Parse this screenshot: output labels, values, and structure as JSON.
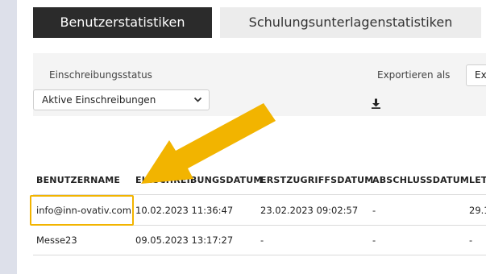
{
  "tabs": [
    {
      "label": "Benutzerstatistiken",
      "active": true
    },
    {
      "label": "Schulungsunterlagenstatistiken",
      "active": false
    }
  ],
  "filter": {
    "label": "Einschreibungsstatus",
    "selected": "Aktive Einschreibungen"
  },
  "export": {
    "label": "Exportieren als",
    "selected": "Ex"
  },
  "table": {
    "columns": [
      "BENUTZERNAME",
      "EINSCHREIBUNGSDATUM",
      "ERSTZUGRIFFSDATUM",
      "ABSCHLUSSDATUM",
      "LET"
    ],
    "rows": [
      [
        "info@inn-ovativ.com",
        "10.02.2023 11:36:47",
        "23.02.2023 09:02:57",
        "-",
        "29.1"
      ],
      [
        "Messe23",
        "09.05.2023 13:17:27",
        "-",
        "-",
        "-"
      ]
    ]
  },
  "icons": {
    "chevron": "chevron-down-icon",
    "download": "download-icon",
    "annotation_arrow": "arrow-icon"
  },
  "colors": {
    "active_tab": "#2b2b2b",
    "inactive_tab": "#ececec",
    "highlight": "#f2b400",
    "arrow": "#f2b400"
  }
}
